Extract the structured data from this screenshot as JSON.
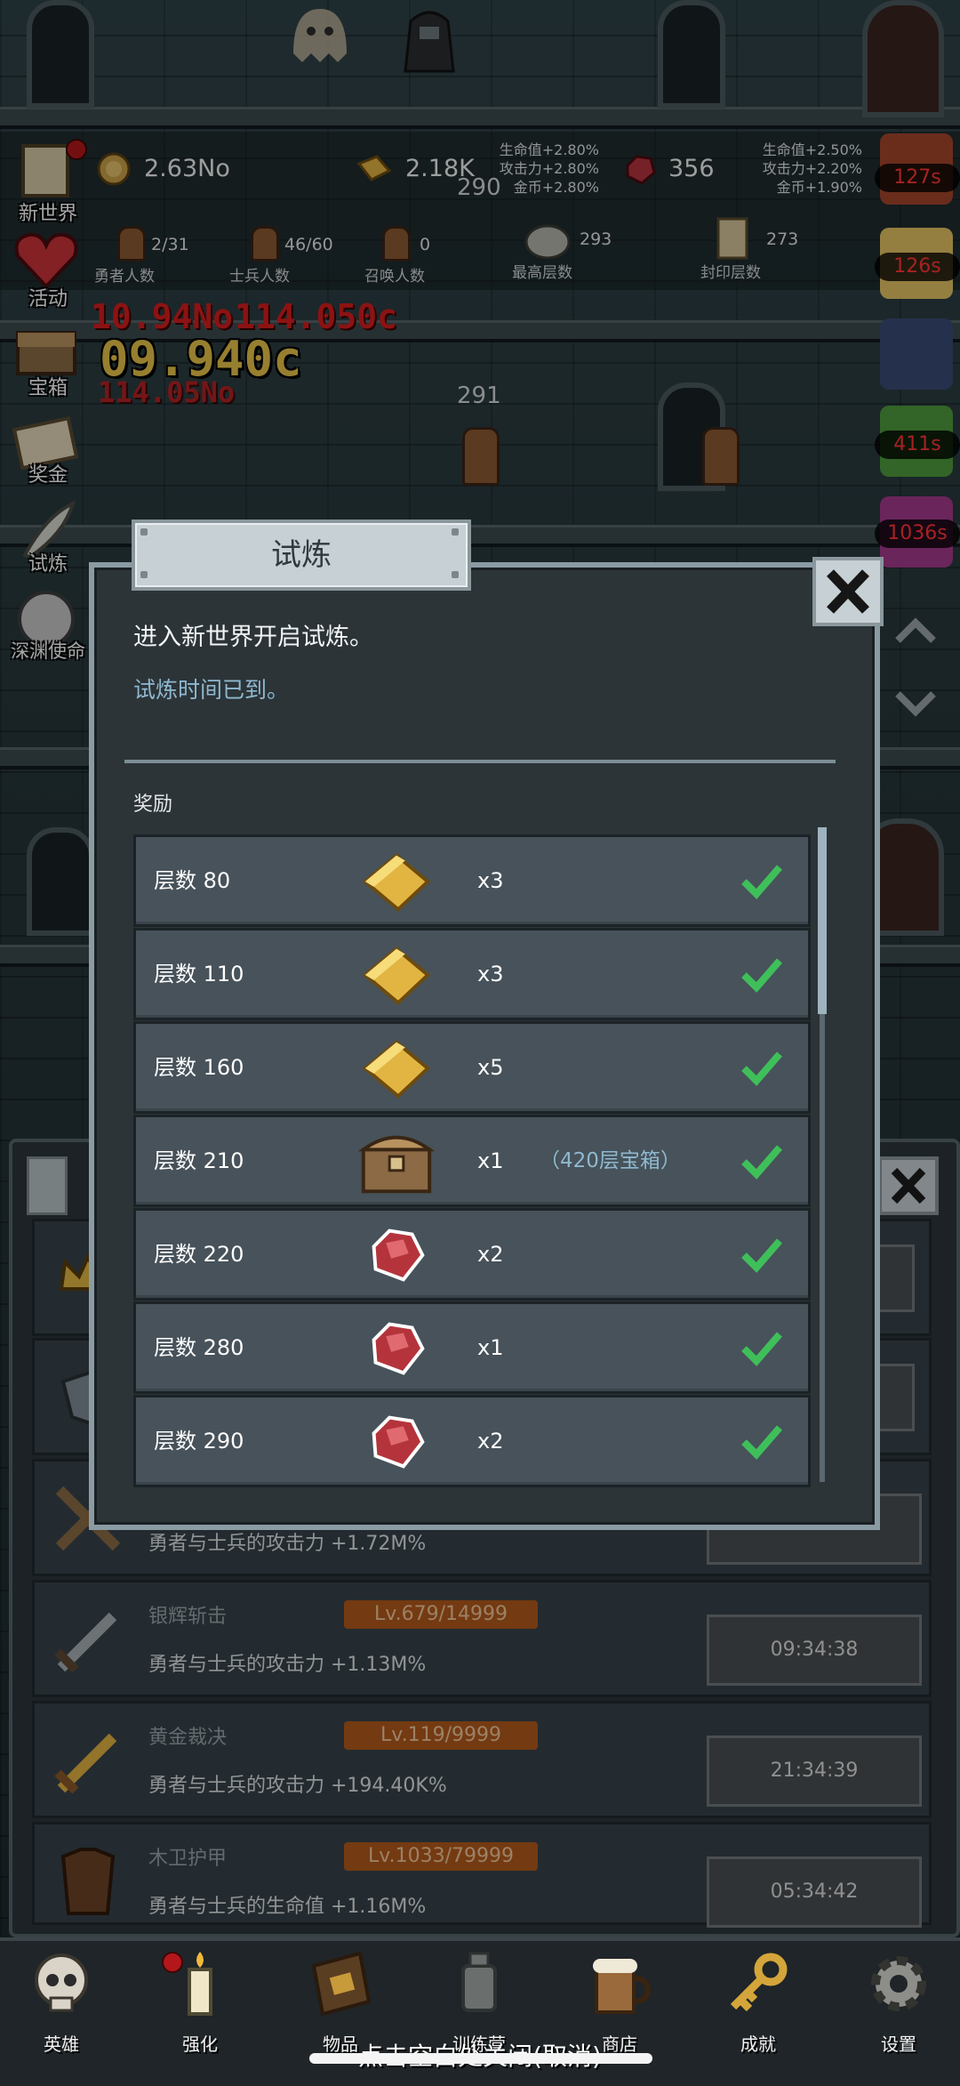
{
  "resources": {
    "gold_coins": "2.63No",
    "gold_bars": "2.18K",
    "rubies": "356",
    "bonus_left": [
      "生命值+2.80%",
      "攻击力+2.80%",
      "金币+2.80%"
    ],
    "bonus_right": [
      "生命值+2.50%",
      "攻击力+2.20%",
      "金币+1.90%"
    ]
  },
  "stats": {
    "heroes": {
      "value": "2/31",
      "label": "勇者人数"
    },
    "soldiers": {
      "value": "46/60",
      "label": "士兵人数"
    },
    "summons": {
      "value": "0",
      "label": "召唤人数"
    },
    "highest_floor": {
      "value": "293",
      "label": "最高层数"
    },
    "seal_floor": {
      "value": "273",
      "label": "封印层数"
    }
  },
  "floors": {
    "upper": "290",
    "middle": "291"
  },
  "damage_text": {
    "red1": "10.94No",
    "red2": "114.050c",
    "yellow": "09.940c",
    "red3": "114.05No"
  },
  "side_nav": [
    "新世界",
    "活动",
    "宝箱",
    "奖金",
    "试炼",
    "深渊使命"
  ],
  "timers": [
    "127s",
    "126s",
    "411s",
    "1036s"
  ],
  "modal": {
    "title": "试炼",
    "message": "进入新世界开启试炼。",
    "status": "试炼时间已到。",
    "reward_label": "奖励",
    "rewards": [
      {
        "floor": "层数 80",
        "item": "gold-bar",
        "qty": "x3",
        "note": ""
      },
      {
        "floor": "层数 110",
        "item": "gold-bar",
        "qty": "x3",
        "note": ""
      },
      {
        "floor": "层数 160",
        "item": "gold-bar",
        "qty": "x5",
        "note": ""
      },
      {
        "floor": "层数 210",
        "item": "treasure-chest",
        "qty": "x1",
        "note": "（420层宝箱）"
      },
      {
        "floor": "层数 220",
        "item": "ruby",
        "qty": "x2",
        "note": ""
      },
      {
        "floor": "层数 280",
        "item": "ruby",
        "qty": "x1",
        "note": ""
      },
      {
        "floor": "层数 290",
        "item": "ruby",
        "qty": "x2",
        "note": ""
      }
    ]
  },
  "equipment": [
    {
      "name": "",
      "level": "",
      "desc": "勇者与士兵的攻击力 +1.72M%",
      "timer": ""
    },
    {
      "name": "银辉斩击",
      "level": "Lv.679/14999",
      "desc": "勇者与士兵的攻击力 +1.13M%",
      "timer": "09:34:38"
    },
    {
      "name": "黄金裁决",
      "level": "Lv.119/9999",
      "desc": "勇者与士兵的攻击力 +194.40K%",
      "timer": "21:34:39"
    },
    {
      "name": "木卫护甲",
      "level": "Lv.1033/79999",
      "desc": "勇者与士兵的生命值 +1.16M%",
      "timer": "05:34:42"
    }
  ],
  "bottom_nav": [
    "英雄",
    "强化",
    "物品",
    "训练营",
    "商店",
    "成就",
    "设置"
  ],
  "hint": "点击空白处关闭(取消)",
  "colors": {
    "accent_blue": "#8fb8cf",
    "check_green": "#3fbf5a",
    "level_orange": "#b3591c",
    "timer_red": "#ff3535"
  }
}
